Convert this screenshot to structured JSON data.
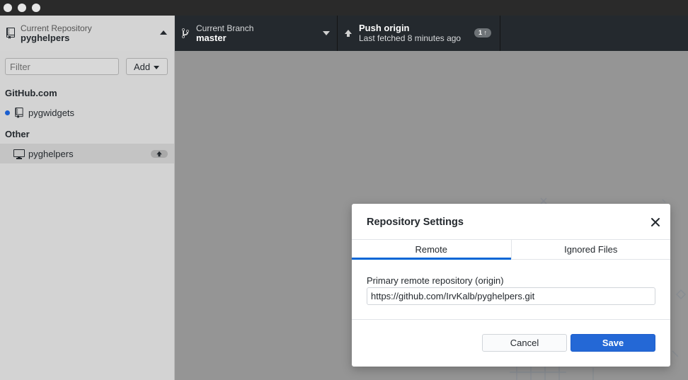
{
  "toolbar": {
    "repository": {
      "description": "Current Repository",
      "title": "pyghelpers",
      "icon": "repo-icon"
    },
    "branch": {
      "description": "Current Branch",
      "title": "master",
      "icon": "git-branch-icon"
    },
    "push": {
      "title": "Push origin",
      "description": "Last fetched 8 minutes ago",
      "ahead_badge": "1",
      "icon": "arrow-up-icon"
    }
  },
  "sidebar": {
    "filter_placeholder": "Filter",
    "add_label": "Add",
    "groups": [
      {
        "header": "GitHub.com",
        "items": [
          {
            "label": "pygwidgets",
            "icon": "repo-icon",
            "changed_indicator": true
          }
        ]
      },
      {
        "header": "Other",
        "items": [
          {
            "label": "pyghelpers",
            "icon": "computer-icon",
            "selected": true,
            "needs_push": true
          }
        ]
      }
    ]
  },
  "dialog": {
    "title": "Repository Settings",
    "tabs": [
      {
        "label": "Remote",
        "active": true
      },
      {
        "label": "Ignored Files",
        "active": false
      }
    ],
    "remote_label": "Primary remote repository (origin)",
    "remote_value": "https://github.com/IrvKalb/pyghelpers.git",
    "cancel_label": "Cancel",
    "save_label": "Save"
  },
  "colors": {
    "accent": "#2468d6",
    "toolbar_bg": "#24292e",
    "sidebar_bg": "#d3d3d3",
    "backdrop": "#959595"
  }
}
